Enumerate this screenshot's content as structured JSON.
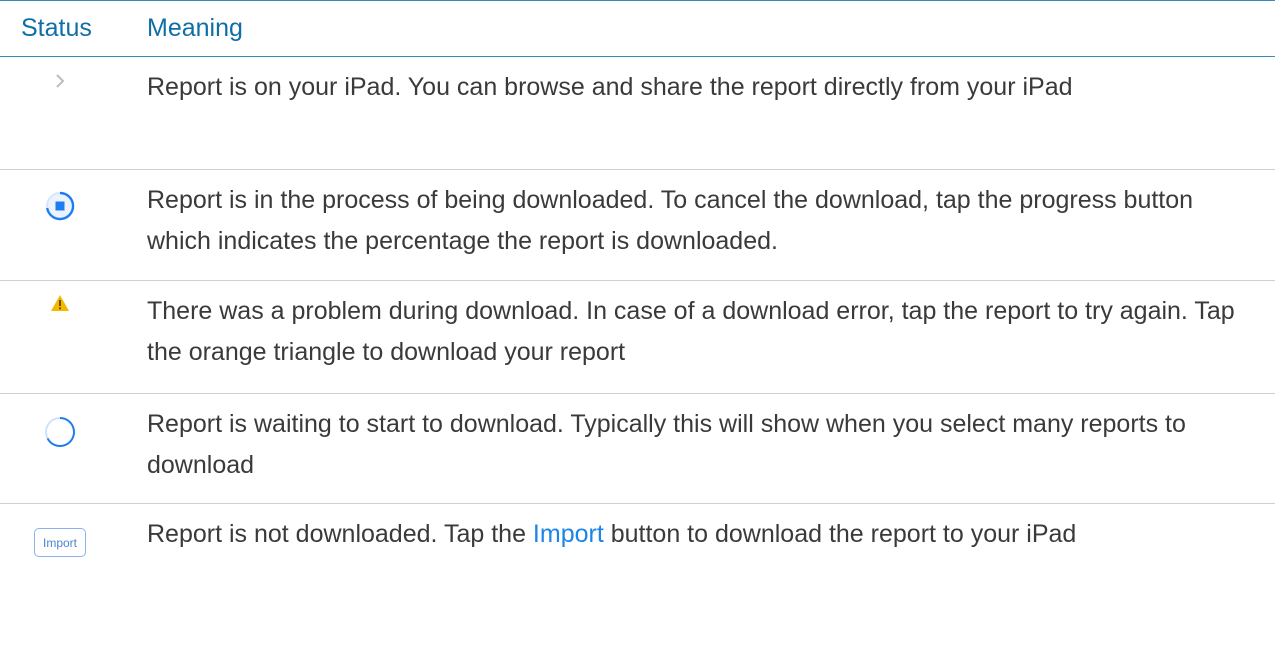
{
  "table": {
    "headers": {
      "status": "Status",
      "meaning": "Meaning"
    },
    "rows": [
      {
        "icon": "chevron-right-icon",
        "text": "Report is on your iPad. You can browse and share the report directly from your iPad"
      },
      {
        "icon": "download-progress-icon",
        "text": "Report is in the process of being downloaded. To cancel the download, tap the progress button which indicates the percentage the report is downloaded."
      },
      {
        "icon": "warning-triangle-icon",
        "text": "There was a problem during download. In case of a download error, tap the report to try again.  Tap the orange triangle to download your report"
      },
      {
        "icon": "waiting-spinner-icon",
        "text": "Report is waiting to start to download. Typically this will show when you select many reports to download"
      },
      {
        "icon": "import-button-icon",
        "icon_label": "Import",
        "text_before": "Report is not downloaded. Tap the ",
        "text_link": "Import",
        "text_after": " button to download the report to your iPad"
      }
    ]
  },
  "colors": {
    "header_text": "#0f6ea7",
    "header_rule": "#3a88b7",
    "row_divider": "#cfcfcf",
    "body_text": "#3a3a3a",
    "link": "#1a84e8",
    "progress_blue": "#1e7cf2",
    "warning_yellow": "#f5b800"
  }
}
